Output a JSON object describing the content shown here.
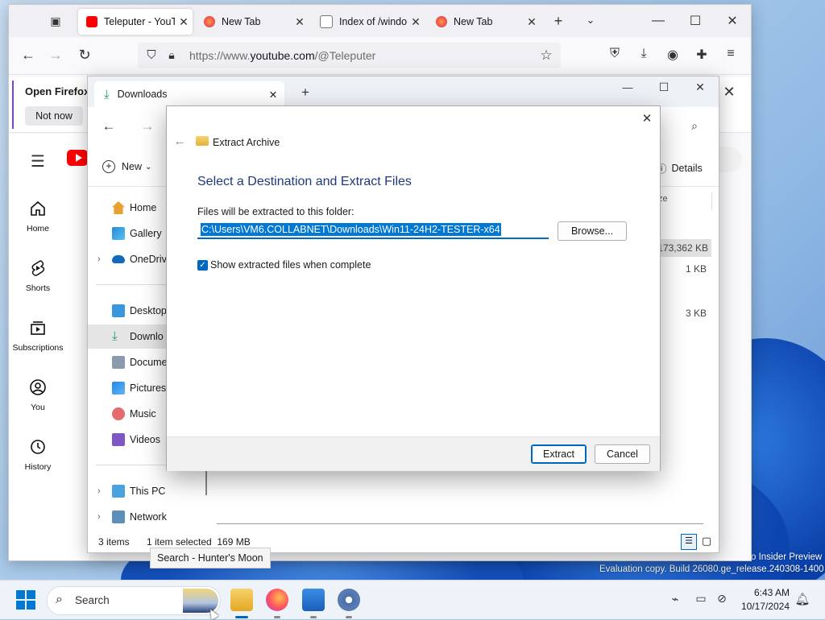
{
  "firefox": {
    "tabs": [
      {
        "title": "Teleputer - YouT",
        "active": true
      },
      {
        "title": "New Tab",
        "active": false
      },
      {
        "title": "Index of /windo",
        "active": false
      },
      {
        "title": "New Tab",
        "active": false
      }
    ],
    "url_scheme": "https://www.",
    "url_host": "youtube.com",
    "url_path": "/@Teleputer",
    "notification_title": "Open Firefox",
    "notification_button": "Not now"
  },
  "youtube": {
    "nav": [
      {
        "label": "Home",
        "icon": "home-icon"
      },
      {
        "label": "Shorts",
        "icon": "shorts-icon"
      },
      {
        "label": "Subscriptions",
        "icon": "subscriptions-icon"
      },
      {
        "label": "You",
        "icon": "you-icon"
      },
      {
        "label": "History",
        "icon": "history-icon"
      }
    ],
    "partial_button": "n"
  },
  "explorer": {
    "tab_title": "Downloads",
    "new_label": "New",
    "details_label": "Details",
    "size_header": "ze",
    "sizes": [
      "173,362 KB",
      "1 KB",
      "3 KB"
    ],
    "nav": [
      {
        "label": "Home"
      },
      {
        "label": "Gallery"
      },
      {
        "label": "OneDriv"
      },
      {
        "label": "Desktop"
      },
      {
        "label": "Downlo"
      },
      {
        "label": "Docume"
      },
      {
        "label": "Pictures"
      },
      {
        "label": "Music"
      },
      {
        "label": "Videos"
      },
      {
        "label": "This PC"
      },
      {
        "label": "Network"
      }
    ],
    "status_items": "3 items",
    "status_selected": "1 item selected  169 MB"
  },
  "dialog": {
    "header": "Extract Archive",
    "heading": "Select a Destination and Extract Files",
    "folder_label": "Files will be extracted to this folder:",
    "path": "C:\\Users\\VM6.COLLABNET\\Downloads\\Win11-24H2-TESTER-x64",
    "browse": "Browse...",
    "checkbox_label": "Show extracted files when complete",
    "checkbox_checked": true,
    "extract": "Extract",
    "cancel": "Cancel"
  },
  "desktop": {
    "watermark_1": "o Insider Preview",
    "watermark_2": "Evaluation copy. Build 26080.ge_release.240308-1400"
  },
  "taskbar": {
    "search_placeholder": "Search",
    "tooltip": "Search - Hunter's Moon",
    "time": "6:43 AM",
    "date": "10/17/2024"
  },
  "colors": {
    "accent": "#0067c0",
    "selection": "#0078d4",
    "youtube_red": "#ff0000",
    "heading_blue": "#1e3a7a"
  }
}
